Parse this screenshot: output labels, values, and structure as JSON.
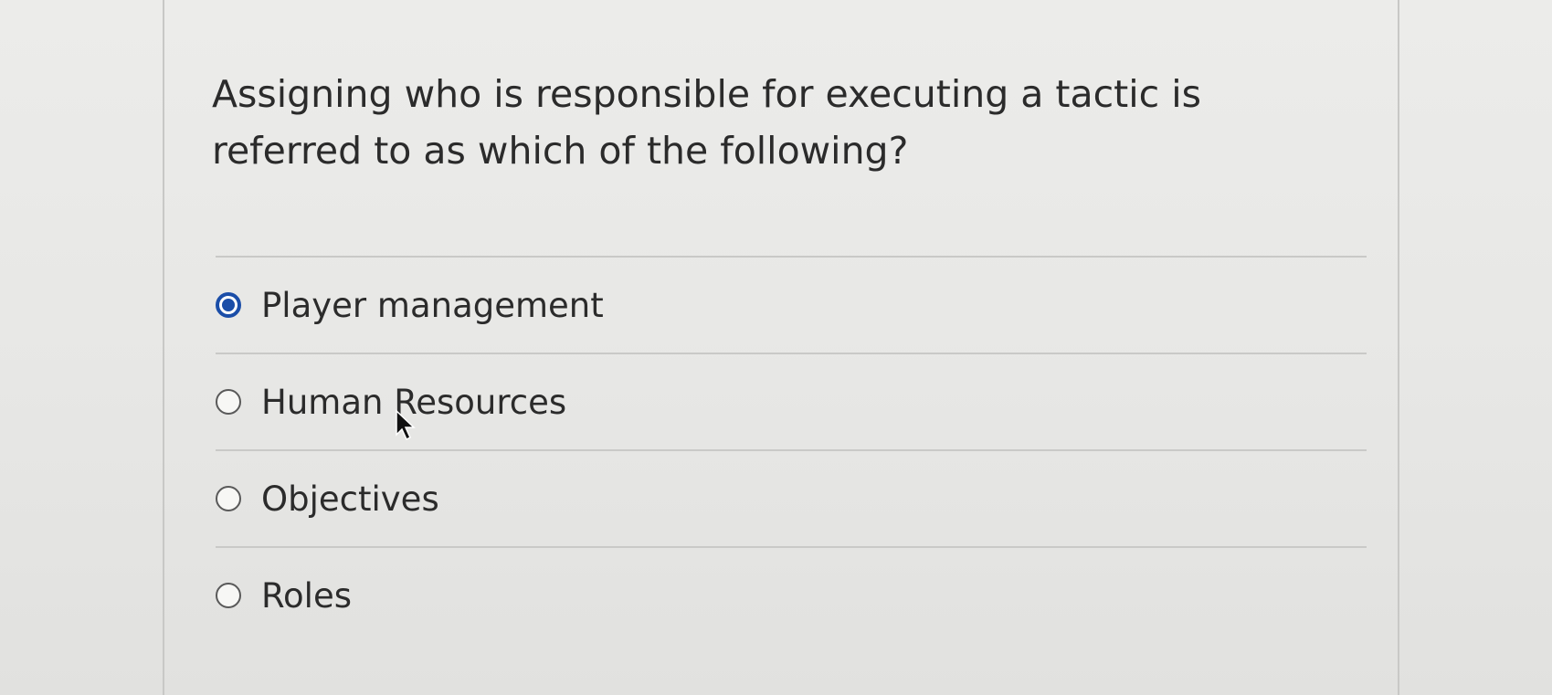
{
  "question": {
    "text": "Assigning who is responsible for executing a tactic is referred to as which of the following?"
  },
  "answers": [
    {
      "label": "Player management",
      "selected": true
    },
    {
      "label": "Human Resources",
      "selected": false
    },
    {
      "label": "Objectives",
      "selected": false
    },
    {
      "label": "Roles",
      "selected": false
    }
  ],
  "colors": {
    "selected_radio": "#1b4ea8",
    "text": "#2b2b2b",
    "background": "#e9e9e7"
  },
  "icons": {
    "cursor": "mouse-pointer-icon"
  }
}
